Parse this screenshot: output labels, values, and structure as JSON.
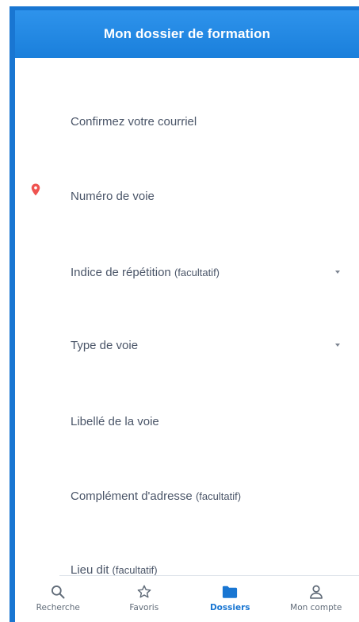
{
  "header": {
    "title": "Mon dossier de formation"
  },
  "form": {
    "fields": [
      {
        "label": "Confirmez votre courriel",
        "optional": ""
      },
      {
        "label": "Numéro de voie",
        "optional": ""
      },
      {
        "label": "Indice de répétition",
        "optional": "(facultatif)"
      },
      {
        "label": "Type de voie",
        "optional": ""
      },
      {
        "label": "Libellé de la voie",
        "optional": ""
      },
      {
        "label": "Complément d'adresse",
        "optional": "(facultatif)"
      },
      {
        "label": "Lieu dit",
        "optional": "(facultatif)"
      }
    ]
  },
  "tabbar": {
    "tabs": [
      {
        "label": "Recherche",
        "icon": "search-icon",
        "active": false
      },
      {
        "label": "Favoris",
        "icon": "star-icon",
        "active": false
      },
      {
        "label": "Dossiers",
        "icon": "folder-icon",
        "active": true
      },
      {
        "label": "Mon compte",
        "icon": "user-icon",
        "active": false
      }
    ]
  },
  "colors": {
    "primary": "#1976d2",
    "header": "#2e93ec",
    "pin": "#ef5350",
    "label": "#4a5568",
    "inactive_tab": "#606b78"
  }
}
